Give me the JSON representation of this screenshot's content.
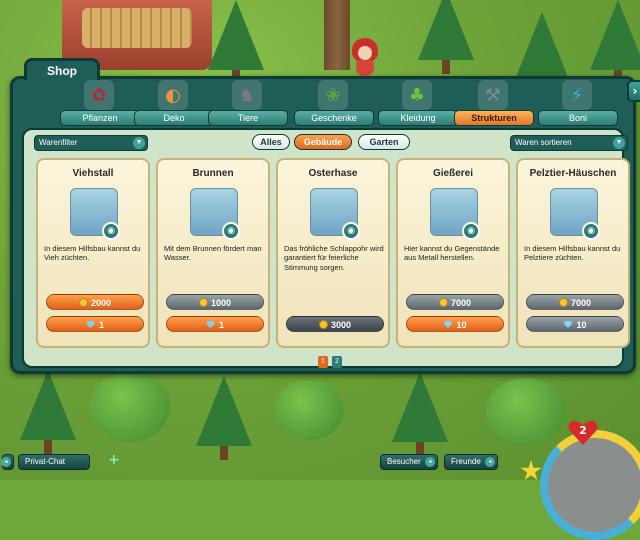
{
  "shop": {
    "title": "Shop",
    "close_label": "›",
    "categories": [
      {
        "label": "Pflanzen",
        "icon": "flower-bouquet-icon",
        "glyph": "✿",
        "color": "#b8283a"
      },
      {
        "label": "Deko",
        "icon": "palette-icon",
        "glyph": "◐",
        "color": "#e8953a"
      },
      {
        "label": "Tiere",
        "icon": "donkey-icon",
        "glyph": "♞",
        "color": "#7a7a8a"
      },
      {
        "label": "Geschenke",
        "icon": "gift-card-icon",
        "glyph": "❀",
        "color": "#5aa43a"
      },
      {
        "label": "Kleidung",
        "icon": "tshirt-icon",
        "glyph": "♣",
        "color": "#6ac23a"
      },
      {
        "label": "Strukturen",
        "icon": "structure-tools-icon",
        "glyph": "⚒",
        "color": "#7a8a94"
      },
      {
        "label": "Boni",
        "icon": "lightning-icon",
        "glyph": "⚡",
        "color": "#2ab4d8"
      }
    ],
    "active_category": "Strukturen",
    "filter_dropdown": "Warenfilter",
    "sort_dropdown": "Waren sortieren",
    "subtabs": [
      {
        "label": "Alles",
        "active": false
      },
      {
        "label": "Gebäude",
        "active": true
      },
      {
        "label": "Garten",
        "active": false
      }
    ],
    "items": [
      {
        "title": "Viehstall",
        "image_icon": "cattle-barn-icon",
        "description": "In diesem Hilfsbau kannst du Vieh züchten.",
        "coin_price": "2000",
        "coin_style": "orange",
        "gem_price": "1",
        "gem_style": "orange"
      },
      {
        "title": "Brunnen",
        "image_icon": "well-icon",
        "description": "Mit dem Brunnen fördert man Wasser.",
        "coin_price": "1000",
        "coin_style": "grey",
        "gem_price": "1",
        "gem_style": "orange"
      },
      {
        "title": "Osterhase",
        "image_icon": "easter-bunny-icon",
        "description": "Das fröhliche Schlappohr wird garantiert für feierliche Stimmung sorgen.",
        "coin_price": "3000",
        "coin_style": "dark",
        "gem_price": null,
        "gem_style": null
      },
      {
        "title": "Gießerei",
        "image_icon": "foundry-icon",
        "description": "Hier kannst du Gegenstände aus Metall herstellen.",
        "coin_price": "7000",
        "coin_style": "grey",
        "gem_price": "10",
        "gem_style": "orange"
      },
      {
        "title": "Pelztier-Häuschen",
        "image_icon": "fur-animal-hut-icon",
        "description": "In diesem Hilfsbau kannst du Pelztiere züchten.",
        "coin_price": "7000",
        "coin_style": "grey",
        "gem_price": "10",
        "gem_style": "grey"
      }
    ],
    "pages": [
      "1",
      "2"
    ],
    "current_page": "1"
  },
  "bottom_bar": {
    "private_chat": "Privat-Chat",
    "visitors": "Besucher",
    "friends": "Freunde"
  },
  "player": {
    "level": "2"
  },
  "colors": {
    "panel": "#1f5d57",
    "accent": "#e0772a",
    "card": "#fbf5dc"
  }
}
